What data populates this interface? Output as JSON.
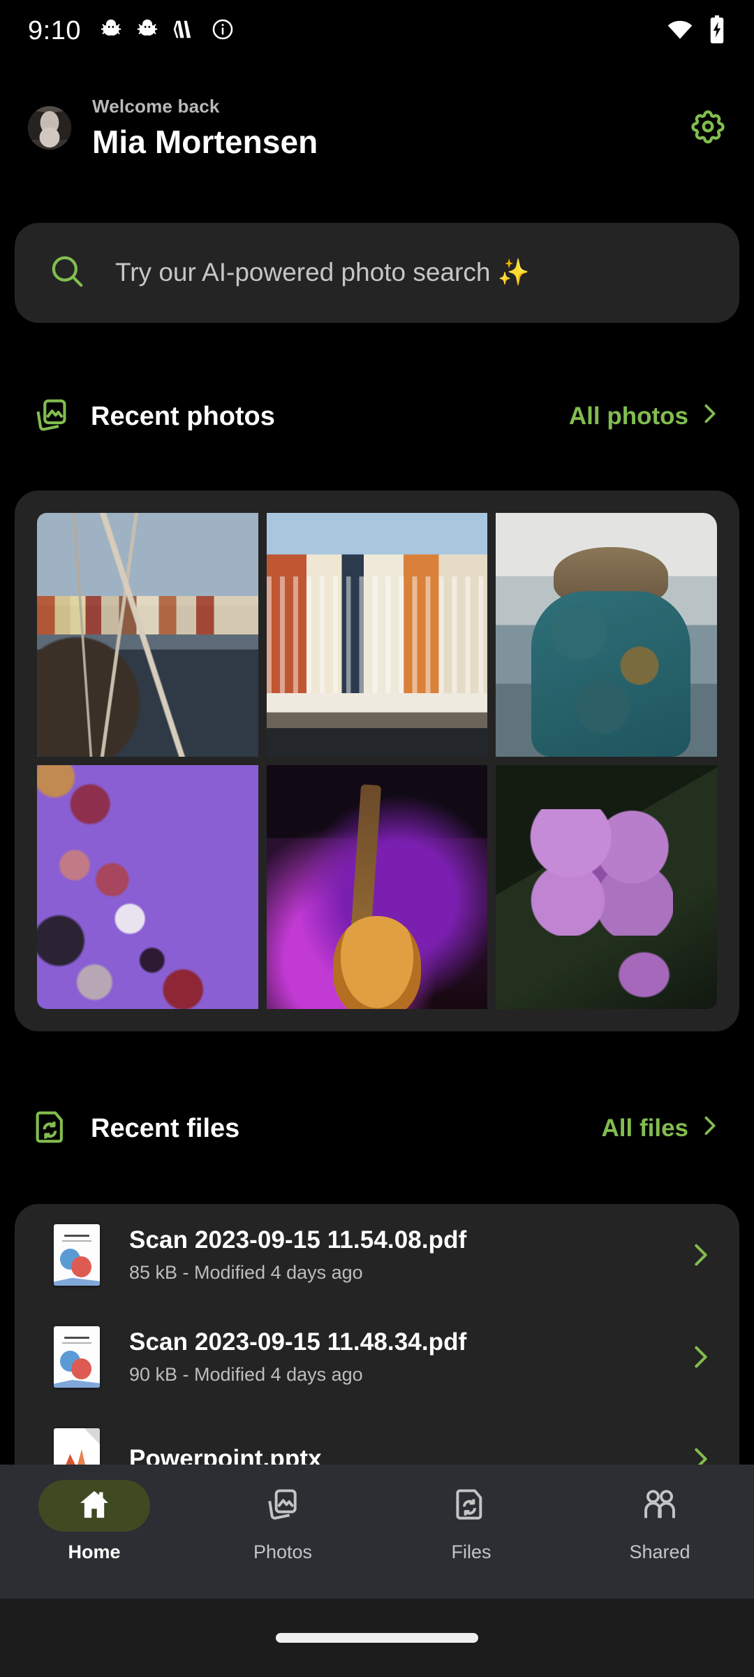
{
  "status_bar": {
    "time": "9:10",
    "left_icons": [
      "bug-icon",
      "bug-icon",
      "chevrons-icon",
      "info-icon"
    ],
    "right_icons": [
      "wifi-icon",
      "battery-charging-icon"
    ]
  },
  "header": {
    "welcome_label": "Welcome back",
    "user_name": "Mia Mortensen",
    "avatar_name": "user-avatar",
    "settings_icon": "gear-icon"
  },
  "search": {
    "placeholder": "Try our AI-powered photo search ",
    "sparkle": "✨",
    "icon": "search-icon"
  },
  "photos_section": {
    "icon": "photos-stack-icon",
    "title": "Recent photos",
    "link_label": "All photos",
    "link_icon": "chevron-right-icon",
    "photos": [
      {
        "name": "photo-nyhavn-boats",
        "alt": "Sailing boats moored in Nyhavn canal"
      },
      {
        "name": "photo-nyhavn-houses",
        "alt": "Colourful townhouses along Nyhavn"
      },
      {
        "name": "photo-woman-jacket",
        "alt": "Woman in teal patterned jacket by the harbour"
      },
      {
        "name": "photo-fruit-purple",
        "alt": "Figs, grapes, onion and berries on purple background"
      },
      {
        "name": "photo-concert-guitar",
        "alt": "Musician with guitar and drum kit on stage"
      },
      {
        "name": "photo-purple-orchid",
        "alt": "Close-up of purple orchid blossoms"
      }
    ]
  },
  "files_section": {
    "icon": "folder-sync-icon",
    "title": "Recent files",
    "link_label": "All files",
    "link_icon": "chevron-right-icon",
    "files": [
      {
        "name": "Scan 2023-09-15 11.54.08.pdf",
        "meta": "85 kB - Modified 4 days ago",
        "thumb": "pdf-scan-thumbnail",
        "chevron": "chevron-right-icon"
      },
      {
        "name": "Scan 2023-09-15 11.48.34.pdf",
        "meta": "90 kB - Modified 4 days ago",
        "thumb": "pdf-scan-thumbnail",
        "chevron": "chevron-right-icon"
      },
      {
        "name": "Powerpoint.pptx",
        "meta": "",
        "thumb": "pptx-thumbnail",
        "chevron": "chevron-right-icon"
      }
    ]
  },
  "bottom_nav": {
    "items": [
      {
        "label": "Home",
        "icon": "home-icon",
        "active": true
      },
      {
        "label": "Photos",
        "icon": "photos-stack-icon",
        "active": false
      },
      {
        "label": "Files",
        "icon": "folder-sync-icon",
        "active": false
      },
      {
        "label": "Shared",
        "icon": "people-icon",
        "active": false
      }
    ]
  },
  "colors": {
    "background": "#000000",
    "card": "#242424",
    "accent_green": "#82bd4f",
    "nav_bar": "#2b2e33",
    "active_pill": "#3f4a22",
    "text_primary": "#ffffff",
    "text_secondary": "#bdbdbd",
    "sparkle_yellow": "#f6c945"
  }
}
